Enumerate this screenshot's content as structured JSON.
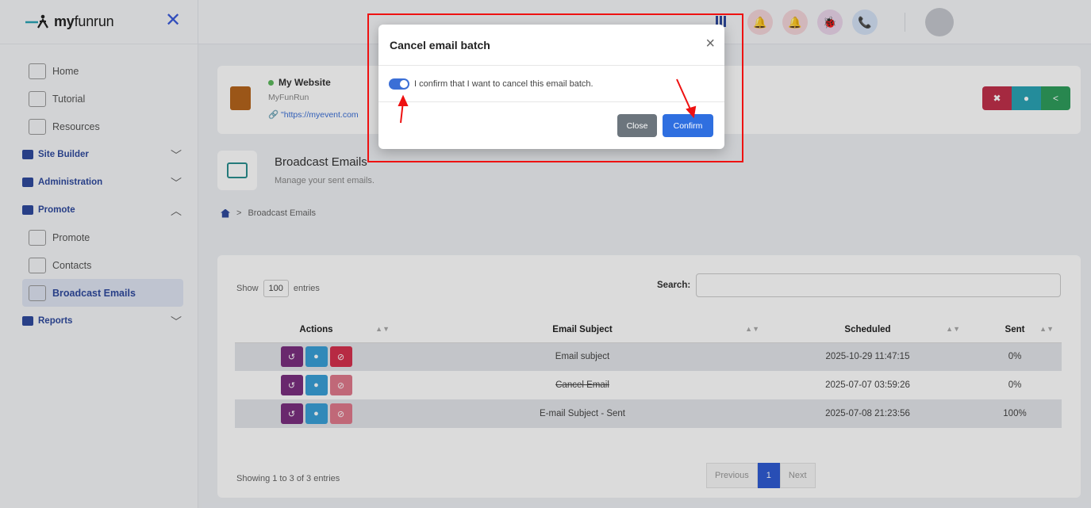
{
  "brand": {
    "name_bold": "my",
    "name_rest": "funrun",
    "close_glyph": "✕"
  },
  "sidebar": {
    "items": [
      {
        "label": "Home",
        "icon": "home-icon"
      },
      {
        "label": "Tutorial",
        "icon": "book-icon"
      },
      {
        "label": "Resources",
        "icon": "folder-icon"
      }
    ],
    "groups": [
      {
        "label": "Site Builder",
        "chevron": "﹀"
      },
      {
        "label": "Administration",
        "chevron": "﹀"
      },
      {
        "label": "Promote",
        "chevron": "︿"
      }
    ],
    "promote_items": [
      {
        "label": "Promote",
        "icon": "megaphone-icon"
      },
      {
        "label": "Contacts",
        "icon": "contacts-icon"
      },
      {
        "label": "Broadcast Emails",
        "icon": "broadcast-icon",
        "active": true
      }
    ],
    "reports": {
      "label": "Reports",
      "chevron": "﹀"
    }
  },
  "site": {
    "name": "My Website",
    "sub": "MyFunRun",
    "url": "\"https://myevent.com"
  },
  "page": {
    "title": "Broadcast Emails",
    "subtitle": "Manage your sent emails.",
    "breadcrumb": "Broadcast Emails"
  },
  "table": {
    "show_label": "Show",
    "entries_count": "100",
    "entries_label": "entries",
    "search_label": "Search:",
    "columns": [
      "Actions",
      "Email Subject",
      "Scheduled",
      "Sent"
    ],
    "rows": [
      {
        "subject": "Email subject",
        "scheduled": "2025-10-29 11:47:15",
        "sent": "0%"
      },
      {
        "subject": "Cancel Email",
        "scheduled": "2025-07-07 03:59:26",
        "sent": "0%"
      },
      {
        "subject": "E-mail Subject - Sent",
        "scheduled": "2025-07-08 21:23:56",
        "sent": "100%"
      }
    ],
    "info": "Showing 1 to 3 of 3 entries",
    "pager": {
      "prev": "Previous",
      "current": "1",
      "next": "Next"
    }
  },
  "modal": {
    "title": "Cancel email batch",
    "close_glyph": "×",
    "confirm_text": "I confirm that I want to cancel this email batch.",
    "toggle_on": true,
    "close_button": "Close",
    "confirm_button": "Confirm"
  },
  "colors": {
    "accent": "#2f6fe0",
    "action_purple": "#7b2f7f",
    "action_blue": "#3aa0d8",
    "action_red": "#d6324f",
    "site_red": "#c0304b",
    "site_teal": "#2aa3b5",
    "site_green": "#2f9e5d",
    "annotation": "#ee1111"
  }
}
